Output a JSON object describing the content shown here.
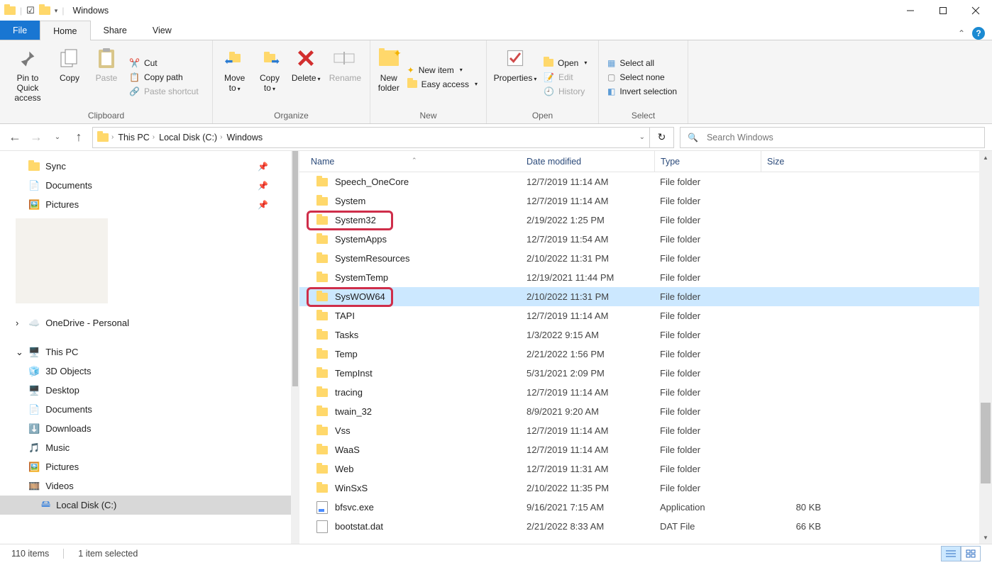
{
  "window": {
    "title": "Windows"
  },
  "tabs": {
    "file": "File",
    "home": "Home",
    "share": "Share",
    "view": "View"
  },
  "ribbon": {
    "clipboard": {
      "label": "Clipboard",
      "pin": "Pin to Quick access",
      "copy": "Copy",
      "paste": "Paste",
      "cut": "Cut",
      "copy_path": "Copy path",
      "paste_shortcut": "Paste shortcut"
    },
    "organize": {
      "label": "Organize",
      "move_to": "Move to",
      "copy_to": "Copy to",
      "delete": "Delete",
      "rename": "Rename"
    },
    "new": {
      "label": "New",
      "new_folder": "New folder",
      "new_item": "New item",
      "easy_access": "Easy access"
    },
    "open": {
      "label": "Open",
      "properties": "Properties",
      "open": "Open",
      "edit": "Edit",
      "history": "History"
    },
    "select": {
      "label": "Select",
      "select_all": "Select all",
      "select_none": "Select none",
      "invert": "Invert selection"
    }
  },
  "breadcrumb": [
    "This PC",
    "Local Disk (C:)",
    "Windows"
  ],
  "search": {
    "placeholder": "Search Windows"
  },
  "headers": {
    "name": "Name",
    "date": "Date modified",
    "type": "Type",
    "size": "Size"
  },
  "nav": {
    "sync": "Sync",
    "documents": "Documents",
    "pictures": "Pictures",
    "onedrive": "OneDrive - Personal",
    "thispc": "This PC",
    "objects3d": "3D Objects",
    "desktop": "Desktop",
    "documents2": "Documents",
    "downloads": "Downloads",
    "music": "Music",
    "pictures2": "Pictures",
    "videos": "Videos",
    "localdisk": "Local Disk (C:)"
  },
  "rows": [
    {
      "name": "Speech_OneCore",
      "date": "12/7/2019 11:14 AM",
      "type": "File folder",
      "size": "",
      "folder": true,
      "sel": false,
      "hl": false
    },
    {
      "name": "System",
      "date": "12/7/2019 11:14 AM",
      "type": "File folder",
      "size": "",
      "folder": true,
      "sel": false,
      "hl": false
    },
    {
      "name": "System32",
      "date": "2/19/2022 1:25 PM",
      "type": "File folder",
      "size": "",
      "folder": true,
      "sel": false,
      "hl": true
    },
    {
      "name": "SystemApps",
      "date": "12/7/2019 11:54 AM",
      "type": "File folder",
      "size": "",
      "folder": true,
      "sel": false,
      "hl": false
    },
    {
      "name": "SystemResources",
      "date": "2/10/2022 11:31 PM",
      "type": "File folder",
      "size": "",
      "folder": true,
      "sel": false,
      "hl": false
    },
    {
      "name": "SystemTemp",
      "date": "12/19/2021 11:44 PM",
      "type": "File folder",
      "size": "",
      "folder": true,
      "sel": false,
      "hl": false
    },
    {
      "name": "SysWOW64",
      "date": "2/10/2022 11:31 PM",
      "type": "File folder",
      "size": "",
      "folder": true,
      "sel": true,
      "hl": true
    },
    {
      "name": "TAPI",
      "date": "12/7/2019 11:14 AM",
      "type": "File folder",
      "size": "",
      "folder": true,
      "sel": false,
      "hl": false
    },
    {
      "name": "Tasks",
      "date": "1/3/2022 9:15 AM",
      "type": "File folder",
      "size": "",
      "folder": true,
      "sel": false,
      "hl": false
    },
    {
      "name": "Temp",
      "date": "2/21/2022 1:56 PM",
      "type": "File folder",
      "size": "",
      "folder": true,
      "sel": false,
      "hl": false
    },
    {
      "name": "TempInst",
      "date": "5/31/2021 2:09 PM",
      "type": "File folder",
      "size": "",
      "folder": true,
      "sel": false,
      "hl": false
    },
    {
      "name": "tracing",
      "date": "12/7/2019 11:14 AM",
      "type": "File folder",
      "size": "",
      "folder": true,
      "sel": false,
      "hl": false
    },
    {
      "name": "twain_32",
      "date": "8/9/2021 9:20 AM",
      "type": "File folder",
      "size": "",
      "folder": true,
      "sel": false,
      "hl": false
    },
    {
      "name": "Vss",
      "date": "12/7/2019 11:14 AM",
      "type": "File folder",
      "size": "",
      "folder": true,
      "sel": false,
      "hl": false
    },
    {
      "name": "WaaS",
      "date": "12/7/2019 11:14 AM",
      "type": "File folder",
      "size": "",
      "folder": true,
      "sel": false,
      "hl": false
    },
    {
      "name": "Web",
      "date": "12/7/2019 11:31 AM",
      "type": "File folder",
      "size": "",
      "folder": true,
      "sel": false,
      "hl": false
    },
    {
      "name": "WinSxS",
      "date": "2/10/2022 11:35 PM",
      "type": "File folder",
      "size": "",
      "folder": true,
      "sel": false,
      "hl": false
    },
    {
      "name": "bfsvc.exe",
      "date": "9/16/2021 7:15 AM",
      "type": "Application",
      "size": "80 KB",
      "folder": false,
      "sel": false,
      "hl": false,
      "exe": true
    },
    {
      "name": "bootstat.dat",
      "date": "2/21/2022 8:33 AM",
      "type": "DAT File",
      "size": "66 KB",
      "folder": false,
      "sel": false,
      "hl": false
    }
  ],
  "status": {
    "items": "110 items",
    "selected": "1 item selected"
  }
}
